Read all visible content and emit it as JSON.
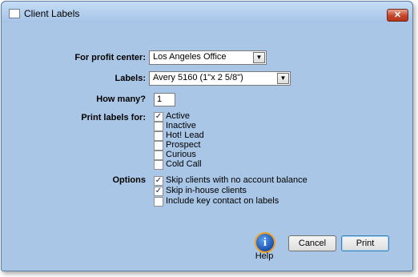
{
  "window": {
    "title": "Client Labels",
    "close_glyph": "✕"
  },
  "form": {
    "profit_center": {
      "label": "For profit center:",
      "value": "Los Angeles Office"
    },
    "labels": {
      "label": "Labels:",
      "value": "Avery 5160 (1\"x 2 5/8\")"
    },
    "how_many": {
      "label": "How many?",
      "value": "1"
    },
    "print_for": {
      "label": "Print labels for:",
      "items": [
        {
          "label": "Active",
          "checked": true
        },
        {
          "label": "Inactive",
          "checked": false
        },
        {
          "label": "Hot! Lead",
          "checked": false
        },
        {
          "label": "Prospect",
          "checked": false
        },
        {
          "label": "Curious",
          "checked": false
        },
        {
          "label": "Cold Call",
          "checked": false
        }
      ]
    },
    "options": {
      "label": "Options",
      "items": [
        {
          "label": "Skip clients with no account balance",
          "checked": true
        },
        {
          "label": "Skip in-house clients",
          "checked": true
        },
        {
          "label": "Include key contact on labels",
          "checked": false
        }
      ]
    }
  },
  "buttons": {
    "help": "Help",
    "help_glyph": "i",
    "cancel": "Cancel",
    "print": "Print"
  },
  "icons": {
    "dropdown": "▼",
    "check": "✓"
  }
}
